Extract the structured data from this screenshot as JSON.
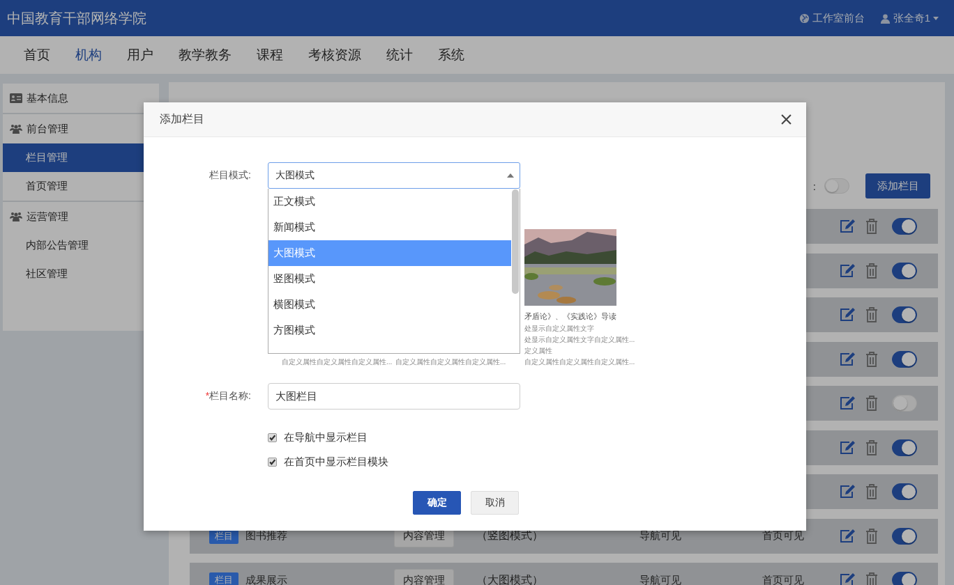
{
  "header": {
    "title": "中国教育干部网络学院",
    "links": [
      {
        "label": "工作室前台",
        "kind": "globe"
      },
      {
        "label": "张全奇1",
        "kind": "user"
      }
    ]
  },
  "nav": [
    {
      "label": "首页",
      "selected": false
    },
    {
      "label": "机构",
      "selected": true
    },
    {
      "label": "用户",
      "selected": false
    },
    {
      "label": "教学教务",
      "selected": false
    },
    {
      "label": "课程",
      "selected": false
    },
    {
      "label": "考核资源",
      "selected": false
    },
    {
      "label": "统计",
      "selected": false
    },
    {
      "label": "系统",
      "selected": false
    }
  ],
  "sidebar": [
    {
      "label": "基本信息",
      "selected": false
    },
    {
      "label": "前台管理",
      "selected": false,
      "children": [
        {
          "label": "栏目管理",
          "selected": true
        },
        {
          "label": "首页管理",
          "selected": false
        }
      ]
    },
    {
      "label": "运营管理",
      "selected": false,
      "children": [
        {
          "label": "内部公告管理",
          "selected": false
        },
        {
          "label": "社区管理",
          "selected": false
        }
      ]
    }
  ],
  "toolbar": {
    "label": ":",
    "on": false,
    "button": "添加栏目"
  },
  "rows": [
    {
      "on": true
    },
    {
      "on": true
    },
    {
      "on": true
    },
    {
      "on": true
    },
    {
      "on": false
    },
    {
      "on": true
    },
    {
      "on": true
    },
    {
      "badge": "栏目",
      "name": "图书推荐",
      "action": "内容管理",
      "mode": "（竖图模式）",
      "nav": "导航可见",
      "home": "首页可见",
      "on": true
    },
    {
      "badge": "栏目",
      "name": "成果展示",
      "action": "内容管理",
      "mode": "（大图模式）",
      "nav": "导航可见",
      "home": "首页可见",
      "on": true
    }
  ],
  "dialog": {
    "title": "添加栏目",
    "mode_label": "栏目模式:",
    "mode_value": "大图模式",
    "options": [
      {
        "label": "正文模式",
        "selected": false
      },
      {
        "label": "新闻模式",
        "selected": false
      },
      {
        "label": "大图模式",
        "selected": true
      },
      {
        "label": "竖图模式",
        "selected": false
      },
      {
        "label": "横图模式",
        "selected": false
      },
      {
        "label": "方图模式",
        "selected": false
      }
    ],
    "previews": [
      {
        "lines": [
          "自定义属性自定义属性自定义属性..."
        ]
      },
      {
        "lines": [
          "自定义属性自定义属性自定义属性..."
        ]
      },
      {
        "kind": "picture",
        "title": "矛盾论》、《实践论》导读",
        "lines": [
          "处显示自定义属性文字",
          "处显示自定义属性文字自定义属性...",
          "定义属性",
          "自定义属性自定义属性自定义属性..."
        ]
      }
    ],
    "name_label": "栏目名称:",
    "required_mark": "*",
    "name_value": "大图栏目",
    "checkboxes": [
      {
        "label": "在导航中显示栏目",
        "checked": true
      },
      {
        "label": "在首页中显示栏目模块",
        "checked": true
      }
    ],
    "buttons": [
      {
        "label": "确定",
        "kind": "primary"
      },
      {
        "label": "取消",
        "kind": "default"
      }
    ]
  }
}
